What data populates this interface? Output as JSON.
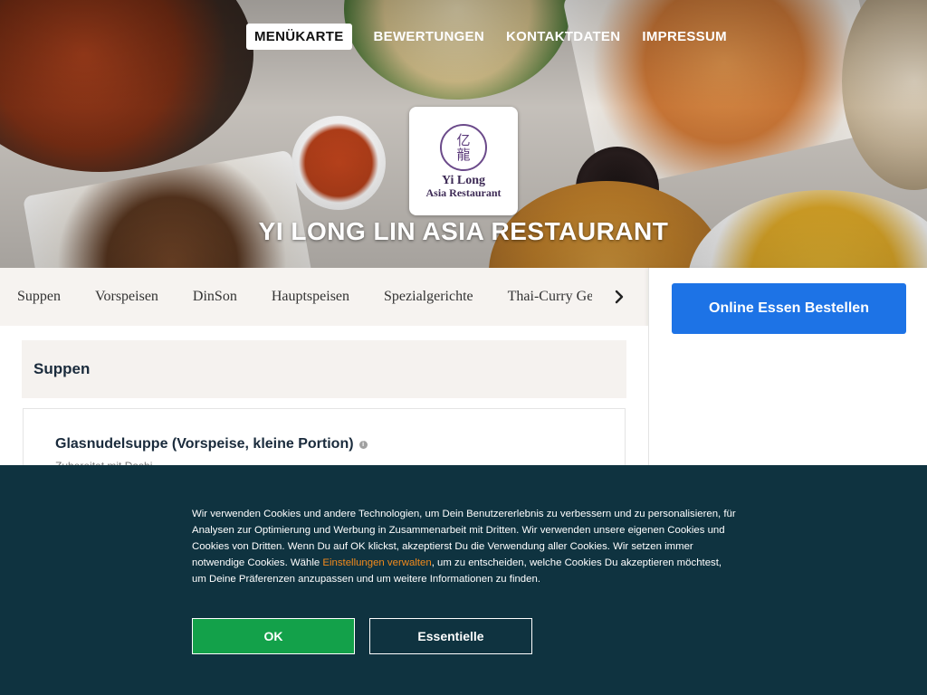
{
  "nav": {
    "items": [
      {
        "label": "MENÜKARTE",
        "active": true
      },
      {
        "label": "BEWERTUNGEN",
        "active": false
      },
      {
        "label": "KONTAKTDATEN",
        "active": false
      },
      {
        "label": "IMPRESSUM",
        "active": false
      }
    ]
  },
  "logo": {
    "chinese_top": "亿",
    "chinese_bottom": "龍",
    "name": "Yi Long",
    "subtitle": "Asia Restaurant"
  },
  "restaurant": {
    "title": "YI LONG LIN ASIA RESTAURANT"
  },
  "categories": {
    "items": [
      "Suppen",
      "Vorspeisen",
      "DinSon",
      "Hauptspeisen",
      "Spezialgerichte",
      "Thai-Curry Gerichte"
    ],
    "next_icon": "chevron-right-icon"
  },
  "sidebar": {
    "order_button": "Online Essen Bestellen"
  },
  "menu": {
    "section_title": "Suppen",
    "dish": {
      "name": "Glasnudelsuppe (Vorspeise, kleine Portion)",
      "info_icon": "info-icon",
      "description": "Zubereitet mit Dashi"
    }
  },
  "cookie": {
    "text_before": "Wir verwenden Cookies und andere Technologien, um Dein Benutzererlebnis zu verbessern und zu personalisieren, für Analysen zur Optimierung und Werbung in Zusammenarbeit mit Dritten. Wir verwenden unsere eigenen Cookies und Cookies von Dritten. Wenn Du auf OK klickst, akzeptierst Du die Verwendung aller Cookies. Wir setzen immer notwendige Cookies. Wähle ",
    "link": "Einstellungen verwalten",
    "text_after": ", um zu entscheiden, welche Cookies Du akzeptieren möchtest, um Deine Präferenzen anzupassen und um weitere Informationen zu finden.",
    "ok_label": "OK",
    "essential_label": "Essentielle"
  },
  "colors": {
    "brand_blue": "#1d73e6",
    "cookie_bg": "#0f3340",
    "ok_green": "#13a14a",
    "link_orange": "#f28a1c"
  }
}
